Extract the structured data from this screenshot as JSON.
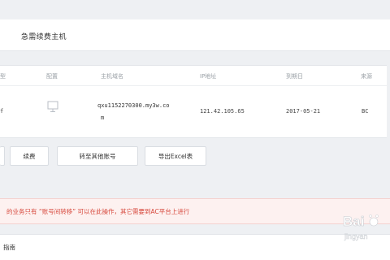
{
  "header": {
    "title": "急需续费主机"
  },
  "table": {
    "columns": {
      "type": "型",
      "config": "配置",
      "hostname": "主机域名",
      "ip": "IP地址",
      "expire": "到期日",
      "source": "来源"
    },
    "row": {
      "type": "f",
      "hostname_line1": "qxu1152270300.my3w.co",
      "hostname_line2": "m",
      "ip": "121.42.105.65",
      "expire": "2017-05-21",
      "source": "BC"
    },
    "config_icon": "monitor-icon"
  },
  "actions": {
    "renew": "续费",
    "transfer": "转至其他账号",
    "export": "导出Excel表"
  },
  "notice": {
    "text": "的业务只有 “账号间转移” 可以在此操作，其它需要到AC平台上进行"
  },
  "footer": {
    "text": "指南"
  },
  "watermark": {
    "brand": "Baidu",
    "sub": "jingyan"
  },
  "colors": {
    "notice_text": "#d7483c",
    "notice_bg": "#fdf1f0"
  }
}
